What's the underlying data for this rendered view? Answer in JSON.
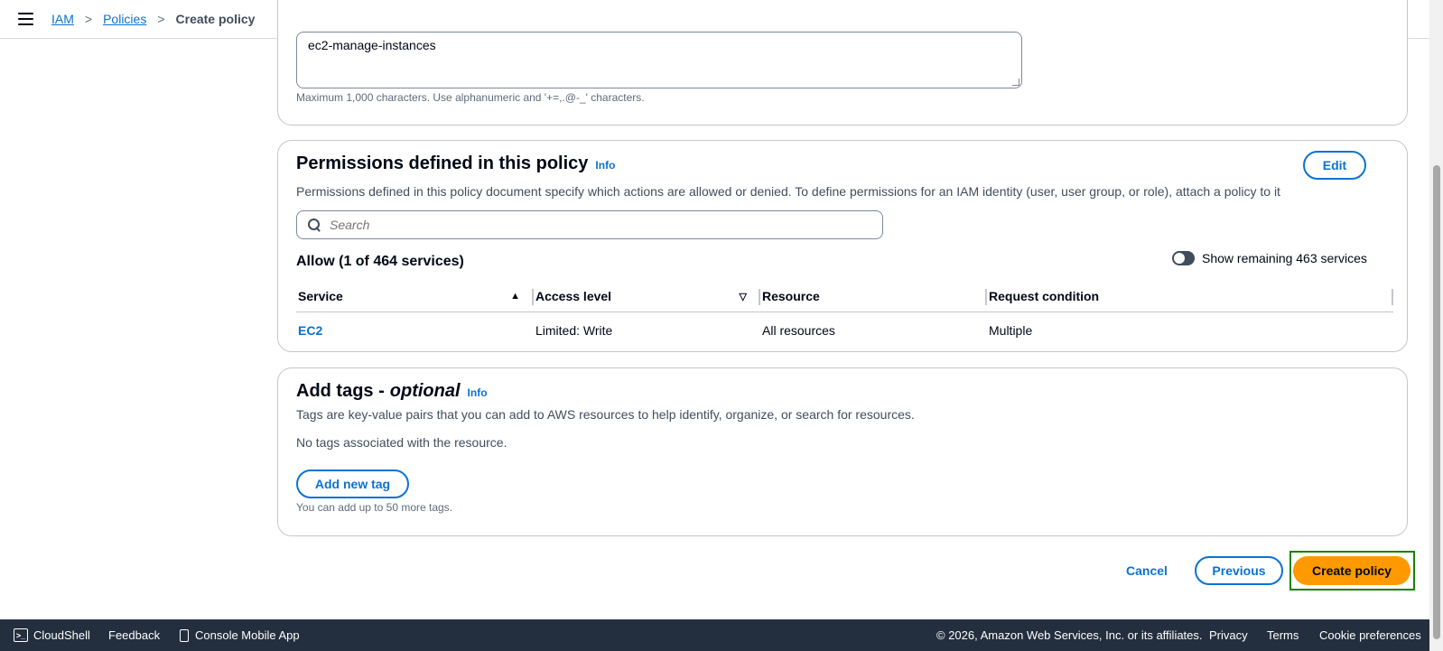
{
  "breadcrumb": {
    "items": [
      "IAM",
      "Policies"
    ],
    "current": "Create policy",
    "separator": ">"
  },
  "description_section": {
    "textarea_value": "ec2-manage-instances",
    "hint": "Maximum 1,000 characters. Use alphanumeric and '+=,.@-_' characters."
  },
  "permissions": {
    "title": "Permissions defined in this policy",
    "info": "Info",
    "edit_label": "Edit",
    "description": "Permissions defined in this policy document specify which actions are allowed or denied. To define permissions for an IAM identity (user, user group, or role), attach a policy to it",
    "search_placeholder": "Search",
    "allow_title": "Allow (1 of 464 services)",
    "toggle_label": "Show remaining 463 services",
    "toggle_on": false,
    "columns": [
      "Service",
      "Access level",
      "Resource",
      "Request condition"
    ],
    "rows": [
      {
        "service": "EC2",
        "access_level": "Limited: Write",
        "resource": "All resources",
        "request_condition": "Multiple"
      }
    ]
  },
  "tags": {
    "title": "Add tags -",
    "title_optional": "optional",
    "info": "Info",
    "description": "Tags are key-value pairs that you can add to AWS resources to help identify, organize, or search for resources.",
    "empty": "No tags associated with the resource.",
    "add_label": "Add new tag",
    "limit_hint": "You can add up to 50 more tags."
  },
  "actions": {
    "cancel": "Cancel",
    "previous": "Previous",
    "create": "Create policy"
  },
  "footer": {
    "cloudshell": "CloudShell",
    "feedback": "Feedback",
    "mobile_app": "Console Mobile App",
    "copyright": "© 2026, Amazon Web Services, Inc. or its affiliates.",
    "privacy": "Privacy",
    "terms": "Terms",
    "cookie": "Cookie preferences"
  },
  "colors": {
    "primary_button": "#ff9900",
    "link": "#0972d3",
    "footer_bg": "#232f3e",
    "highlight": "#1d8102"
  }
}
